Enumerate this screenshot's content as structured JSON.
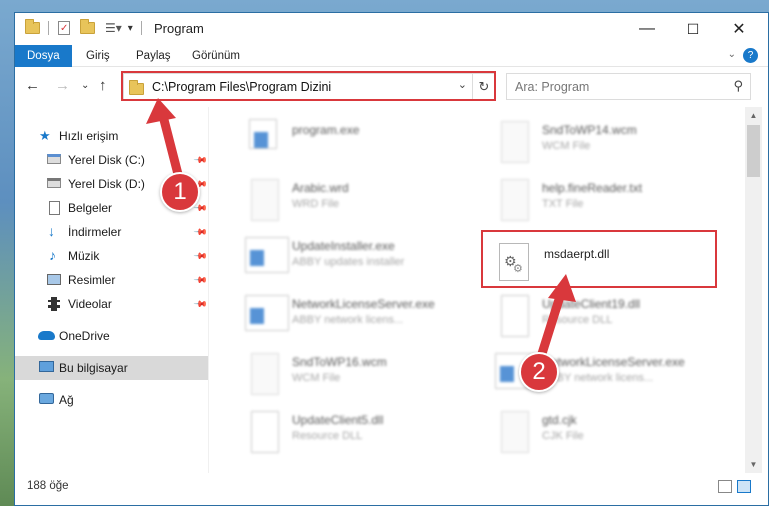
{
  "window": {
    "title": "Program",
    "controls": {
      "minimize": "—",
      "maximize": "☐",
      "close": "✕"
    }
  },
  "ribbon": {
    "tabs": [
      "Dosya",
      "Giriş",
      "Paylaş",
      "Görünüm"
    ]
  },
  "nav": {
    "address_path": "C:\\Program Files\\Program Dizini",
    "search_placeholder": "Ara: Program"
  },
  "sidebar": {
    "items": [
      {
        "label": "Hızlı erişim",
        "icon": "star-icon",
        "pinned": false
      },
      {
        "label": "Yerel Disk (C:)",
        "icon": "drive-icon",
        "pinned": true
      },
      {
        "label": "Yerel Disk (D:)",
        "icon": "drive-icon",
        "pinned": true
      },
      {
        "label": "Belgeler",
        "icon": "documents-icon",
        "pinned": true
      },
      {
        "label": "İndirmeler",
        "icon": "download-icon",
        "pinned": true
      },
      {
        "label": "Müzik",
        "icon": "music-icon",
        "pinned": true
      },
      {
        "label": "Resimler",
        "icon": "pictures-icon",
        "pinned": true
      },
      {
        "label": "Videolar",
        "icon": "videos-icon",
        "pinned": true
      },
      {
        "label": "OneDrive",
        "icon": "cloud-icon",
        "pinned": false
      },
      {
        "label": "Bu bilgisayar",
        "icon": "computer-icon",
        "pinned": false,
        "selected": true
      },
      {
        "label": "Ağ",
        "icon": "network-icon",
        "pinned": false
      }
    ]
  },
  "files": {
    "left": [
      {
        "name": "program.exe",
        "type": ""
      },
      {
        "name": "Arabic.wrd",
        "type": "WRD File"
      },
      {
        "name": "UpdateInstaller.exe",
        "type": "ABBY updates installer"
      },
      {
        "name": "NetworkLicenseServer.exe",
        "type": "ABBY network licens..."
      },
      {
        "name": "SndToWP16.wcm",
        "type": "WCM File"
      },
      {
        "name": "UpdateClient5.dll",
        "type": "Resource DLL"
      }
    ],
    "right": [
      {
        "name": "SndToWP14.wcm",
        "type": "WCM File"
      },
      {
        "name": "help.fineReader.txt",
        "type": "TXT File"
      },
      {
        "name": "msdaerpt.dll",
        "type": "",
        "highlighted": true
      },
      {
        "name": "UpdateClient19.dll",
        "type": "Resource DLL"
      },
      {
        "name": "NetworkLicenseServer.exe",
        "type": "ABBY network licens..."
      },
      {
        "name": "gtd.cjk",
        "type": "CJK File"
      }
    ]
  },
  "status": {
    "count": "188 öğe"
  },
  "annotations": {
    "step1": "1",
    "step2": "2",
    "accent": "#d9383c"
  }
}
